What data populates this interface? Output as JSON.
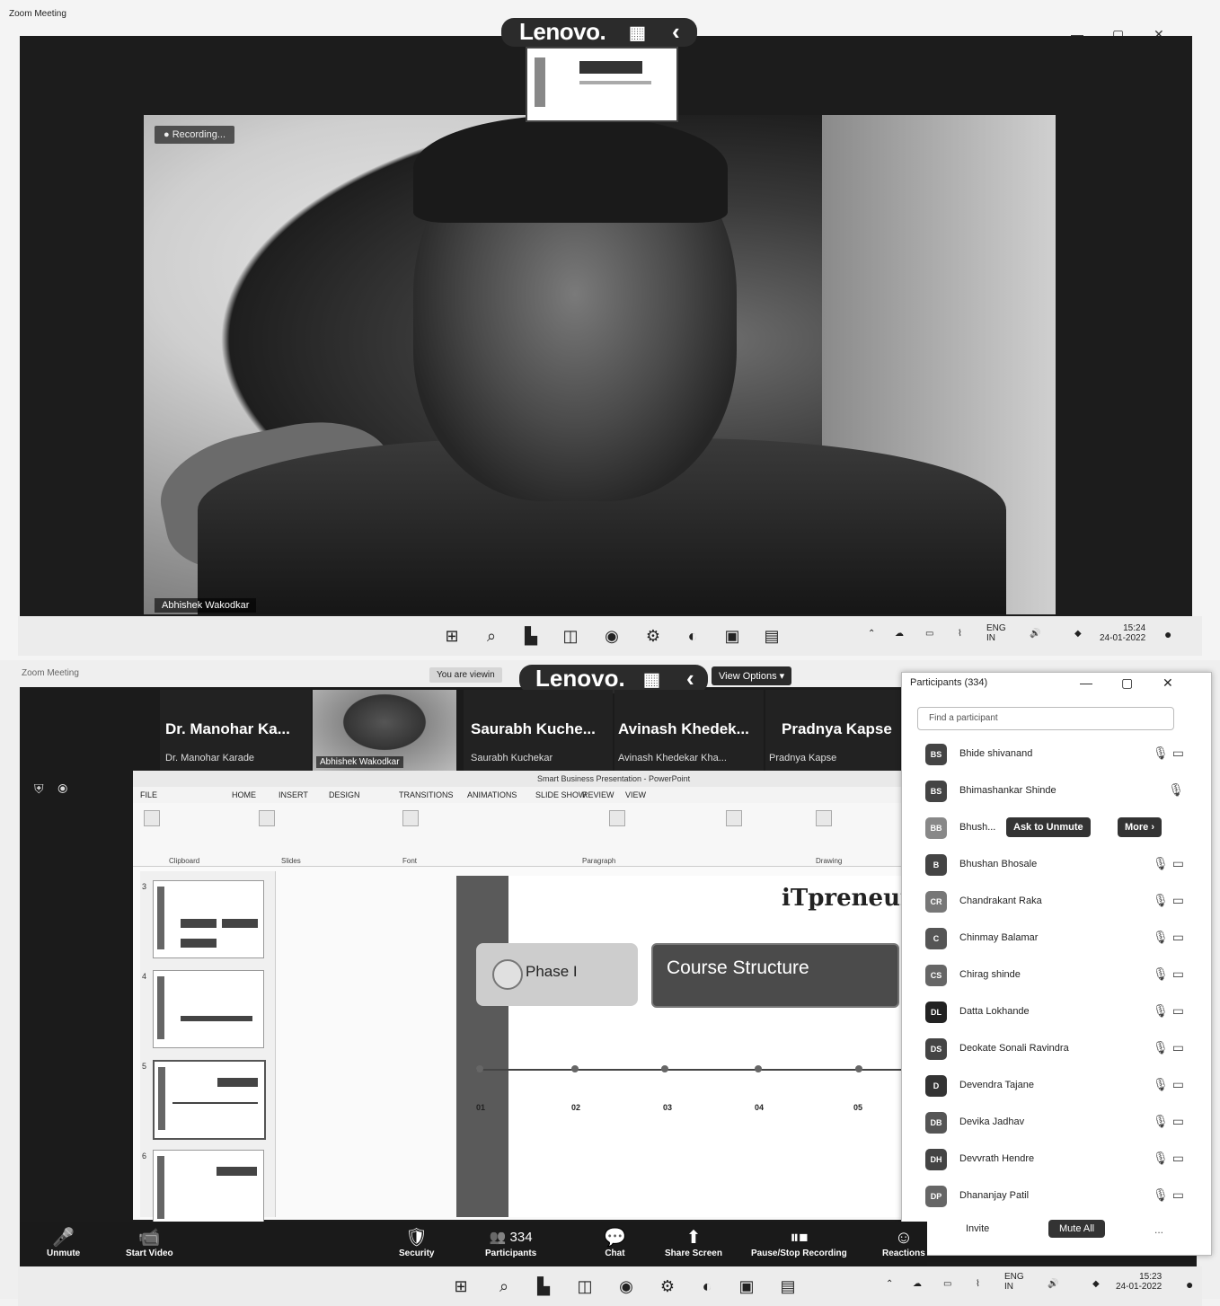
{
  "top": {
    "window_title": "Zoom Meeting",
    "window_controls": [
      "—",
      "▢",
      "✕"
    ],
    "lenovo": "Lenovo.",
    "recording_label": "Recording...",
    "speaker_name": "Abhishek Wakodkar",
    "tray": {
      "lang": "ENG",
      "lang_sub": "IN",
      "time": "15:24",
      "date": "24-01-2022"
    }
  },
  "bottom": {
    "viewing_chip": "You are viewin",
    "lenovo": "Lenovo.",
    "view_options": "View Options ▾",
    "gallery": [
      {
        "name": "Dr. Manohar Ka...",
        "sub": "Dr. Manohar Karade"
      },
      {
        "name": "",
        "sub": "Abhishek Wakodkar"
      },
      {
        "name": "Saurabh Kuche...",
        "sub": "Saurabh Kuchekar"
      },
      {
        "name": "Avinash Khedek...",
        "sub": "Avinash Khedekar Kha..."
      },
      {
        "name": "Pradnya Kapse",
        "sub": "Pradnya Kapse"
      }
    ],
    "ppt": {
      "title": "Smart Business Presentation - PowerPoint",
      "tabs": [
        "FILE",
        "HOME",
        "INSERT",
        "DESIGN",
        "TRANSITIONS",
        "ANIMATIONS",
        "SLIDE SHOW",
        "REVIEW",
        "VIEW"
      ],
      "groups": [
        "Clipboard",
        "Slides",
        "Font",
        "Paragraph",
        "Drawing"
      ],
      "logo": "iTpreneur",
      "phase": "Phase I",
      "course": "Course Structure",
      "timeline_nums": [
        "01",
        "02",
        "03",
        "04",
        "05"
      ],
      "slide_nums": [
        "3",
        "4",
        "5",
        "6"
      ]
    },
    "participants": {
      "title": "Participants (334)",
      "search_placeholder": "Find a participant",
      "ask_unmute": "Ask to Unmute",
      "more": "More ›",
      "rows": [
        {
          "initials": "BS",
          "name": "Bhide shivanand"
        },
        {
          "initials": "BS",
          "name": "Bhimashankar Shinde"
        },
        {
          "initials": "BB",
          "name": "Bhush..."
        },
        {
          "initials": "B",
          "name": "Bhushan Bhosale"
        },
        {
          "initials": "CR",
          "name": "Chandrakant Raka"
        },
        {
          "initials": "C",
          "name": "Chinmay Balamar"
        },
        {
          "initials": "CS",
          "name": "Chirag shinde"
        },
        {
          "initials": "DL",
          "name": "Datta Lokhande"
        },
        {
          "initials": "DS",
          "name": "Deokate Sonali Ravindra"
        },
        {
          "initials": "D",
          "name": "Devendra Tajane"
        },
        {
          "initials": "DB",
          "name": "Devika Jadhav"
        },
        {
          "initials": "DH",
          "name": "Devvrath Hendre"
        },
        {
          "initials": "DP",
          "name": "Dhananjay Patil"
        }
      ],
      "invite": "Invite",
      "mute_all": "Mute All",
      "more_dots": "..."
    },
    "toolbar": [
      {
        "icon": "🎤",
        "label": "Unmute"
      },
      {
        "icon": "📹",
        "label": "Start Video"
      },
      {
        "icon": "🛡",
        "label": "Security"
      },
      {
        "icon": "👥 334",
        "label": "Participants"
      },
      {
        "icon": "💬",
        "label": "Chat"
      },
      {
        "icon": "⬆",
        "label": "Share Screen"
      },
      {
        "icon": "⏸⏹",
        "label": "Pause/Stop Recording"
      },
      {
        "icon": "☺",
        "label": "Reactions"
      }
    ],
    "tray": {
      "lang": "ENG",
      "lang_sub": "IN",
      "time": "15:23",
      "date": "24-01-2022"
    }
  }
}
